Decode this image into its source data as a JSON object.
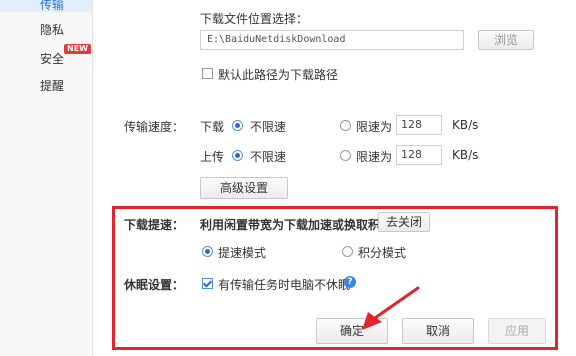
{
  "sidebar": {
    "items": [
      {
        "label": "传输"
      },
      {
        "label": "隐私"
      },
      {
        "label": "安全"
      },
      {
        "label": "提醒"
      }
    ],
    "new_badge": "NEW"
  },
  "download_location": {
    "title": "下载文件位置选择：",
    "path_value": "E:\\BaiduNetdiskDownload",
    "browse_label": "浏览",
    "default_path_label": "默认此路径为下载路径"
  },
  "speed": {
    "label": "传输速度：",
    "download": {
      "label": "下载",
      "unlimited": "不限速",
      "limit": "限速为",
      "value": "128",
      "unit": "KB/s"
    },
    "upload": {
      "label": "上传",
      "unlimited": "不限速",
      "limit": "限速为",
      "value": "128",
      "unit": "KB/s"
    },
    "advanced_button": "高级设置"
  },
  "boost": {
    "label": "下载提速：",
    "description": "利用闲置带宽为下载加速或换取积分",
    "close_button": "去关闭",
    "mode_speed": "提速模式",
    "mode_points": "积分模式"
  },
  "sleep": {
    "label": "休眠设置：",
    "checkbox_label": "有传输任务时电脑不休眠",
    "help_glyph": "?"
  },
  "footer": {
    "ok": "确定",
    "cancel": "取消",
    "apply": "应用"
  },
  "colors": {
    "accent": "#2a72d8",
    "highlight": "#e0262a"
  }
}
